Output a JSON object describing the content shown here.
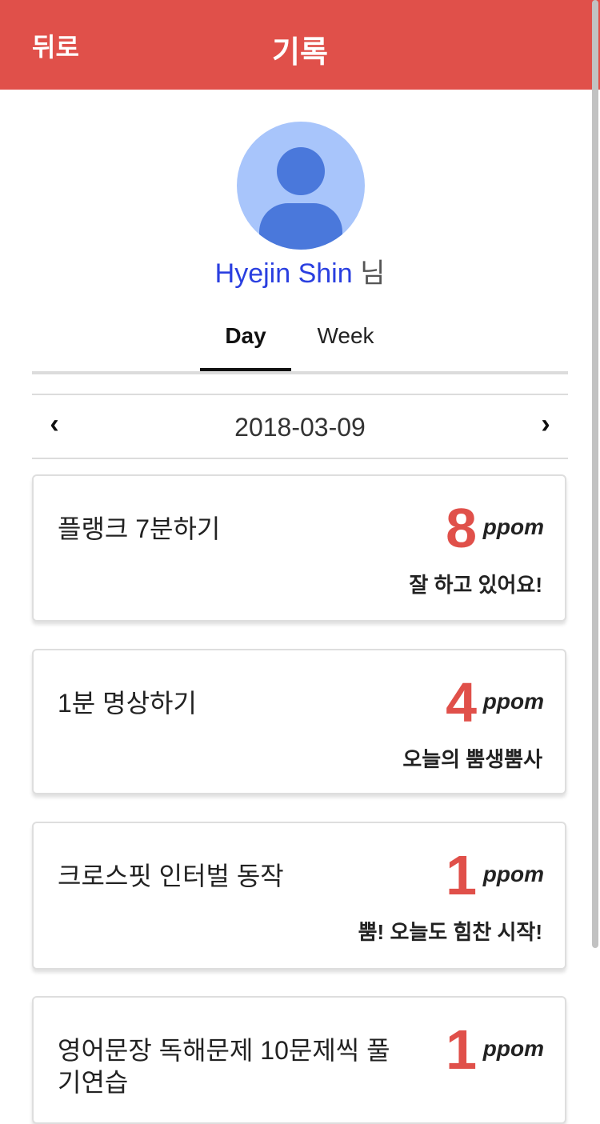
{
  "header": {
    "back_label": "뒤로",
    "title": "기록",
    "color": "#e0504a"
  },
  "profile": {
    "avatar_icon": "user-avatar-icon",
    "name": "Hyejin Shin",
    "suffix": "님"
  },
  "tabs": [
    {
      "label": "Day",
      "active": true
    },
    {
      "label": "Week",
      "active": false
    }
  ],
  "date_nav": {
    "prev_icon": "chevron-left-icon",
    "next_icon": "chevron-right-icon",
    "date": "2018-03-09"
  },
  "records": [
    {
      "title": "플랭크 7분하기",
      "score": "8",
      "unit": "ppom",
      "message": "잘 하고 있어요!"
    },
    {
      "title": "1분 명상하기",
      "score": "4",
      "unit": "ppom",
      "message": "오늘의 뿜생뿜사"
    },
    {
      "title": "크로스핏 인터벌 동작",
      "score": "1",
      "unit": "ppom",
      "message": "뿜! 오늘도 힘찬 시작!"
    },
    {
      "title": "영어문장 독해문제 10문제씩 풀기연습",
      "score": "1",
      "unit": "ppom",
      "message": ""
    }
  ]
}
